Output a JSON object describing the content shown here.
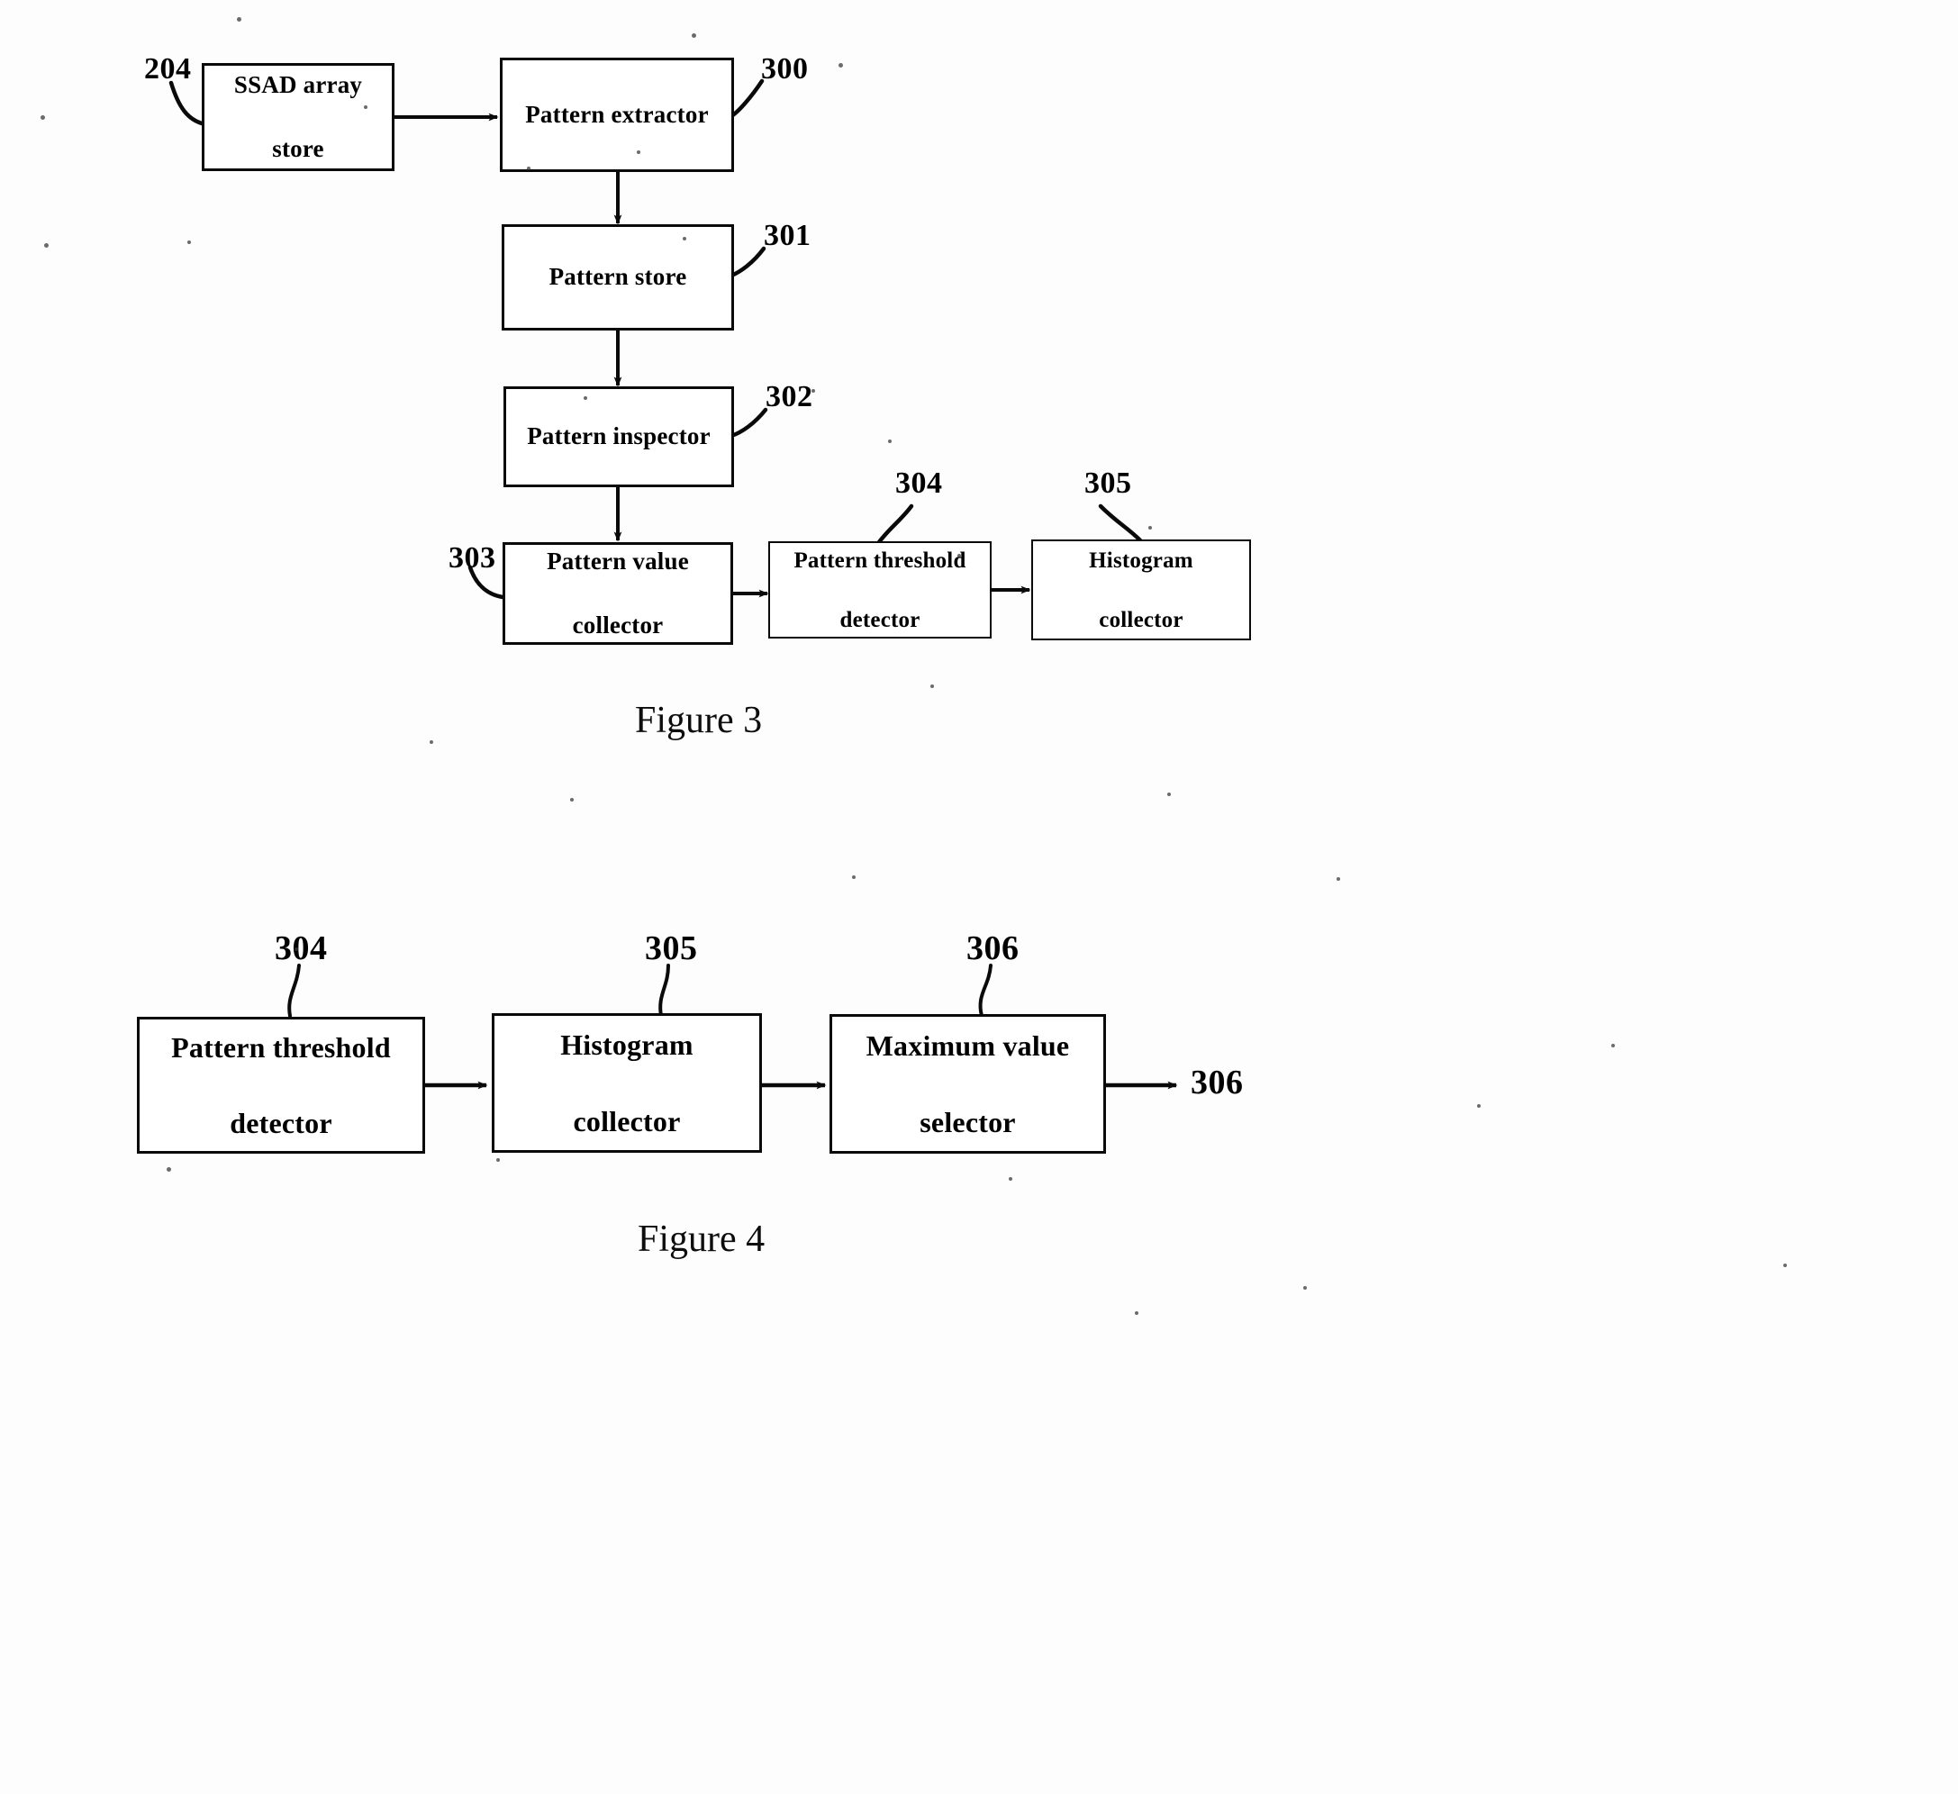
{
  "document": {
    "kind": "patent-drawing-sheet",
    "background_color": "#ffffff",
    "ink_color": "#000000"
  },
  "figures": [
    {
      "id": "figure-3",
      "caption": "Figure 3",
      "nodes": [
        {
          "ref": "204",
          "label_line1": "SSAD array",
          "label_line2": "store"
        },
        {
          "ref": "300",
          "label_line1": "Pattern extractor",
          "label_line2": ""
        },
        {
          "ref": "301",
          "label_line1": "Pattern store",
          "label_line2": ""
        },
        {
          "ref": "302",
          "label_line1": "Pattern inspector",
          "label_line2": ""
        },
        {
          "ref": "303",
          "label_line1": "Pattern value",
          "label_line2": "collector"
        },
        {
          "ref": "304",
          "label_line1": "Pattern threshold",
          "label_line2": "detector"
        },
        {
          "ref": "305",
          "label_line1": "Histogram",
          "label_line2": "collector"
        }
      ]
    },
    {
      "id": "figure-4",
      "caption": "Figure 4",
      "nodes": [
        {
          "ref": "304",
          "label_line1": "Pattern threshold",
          "label_line2": "detector"
        },
        {
          "ref": "305",
          "label_line1": "Histogram",
          "label_line2": "collector"
        },
        {
          "ref": "306",
          "label_line1": "Maximum value",
          "label_line2": "selector"
        }
      ],
      "output_ref": "306"
    }
  ],
  "fig3": {
    "ssad_l1": "SSAD array",
    "ssad_l2": "store",
    "ssad_ref": "204",
    "extractor": "Pattern extractor",
    "extractor_ref": "300",
    "store": "Pattern store",
    "store_ref": "301",
    "inspector": "Pattern inspector",
    "inspector_ref": "302",
    "value_l1": "Pattern value",
    "value_l2": "collector",
    "value_ref": "303",
    "threshold_l1": "Pattern threshold",
    "threshold_l2": "detector",
    "threshold_ref": "304",
    "histogram_l1": "Histogram",
    "histogram_l2": "collector",
    "histogram_ref": "305",
    "caption": "Figure 3"
  },
  "fig4": {
    "threshold_l1": "Pattern threshold",
    "threshold_l2": "detector",
    "threshold_ref": "304",
    "histogram_l1": "Histogram",
    "histogram_l2": "collector",
    "histogram_ref": "305",
    "maximum_l1": "Maximum value",
    "maximum_l2": "selector",
    "maximum_ref": "306",
    "output_ref": "306",
    "caption": "Figure 4"
  }
}
